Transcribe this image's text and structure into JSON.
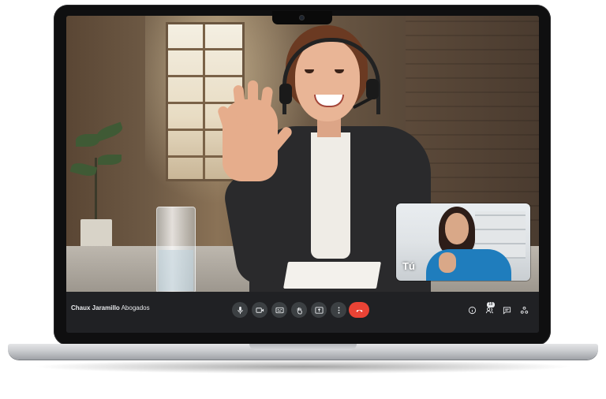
{
  "meeting": {
    "name_bold": "Chaux Jaramillo",
    "name_rest": " Abogados"
  },
  "self_view": {
    "label": "Tú"
  },
  "participants": {
    "count": "18"
  },
  "controls": {
    "buttons": [
      "mic-icon",
      "camera-icon",
      "captions-icon",
      "raise-hand-icon",
      "present-icon",
      "more-icon",
      "hangup-icon"
    ],
    "side": [
      "info-icon",
      "people-icon",
      "chat-icon",
      "activities-icon"
    ]
  },
  "colors": {
    "hangup": "#ea4335",
    "toolbar": "#202124",
    "button": "#3c4043"
  }
}
